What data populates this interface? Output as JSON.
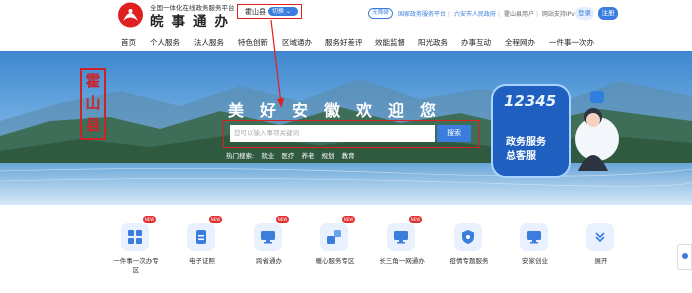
{
  "brand": {
    "subtitle": "全国一体化在线政务服务平台",
    "title": "皖事通办",
    "logo_icon": "anhui-logo-icon",
    "accent": "#e02020"
  },
  "region": {
    "name": "霍山县",
    "switch_label": "切换 ⌄"
  },
  "topbar": {
    "accessibility": "无障碍",
    "links": [
      "国家政务服务平台",
      "六安市人民政府",
      "霍山县用户",
      "网站支持IPv6"
    ],
    "login": "登录",
    "register": "注册",
    "primary_color": "#3b7ddd"
  },
  "nav": [
    "首页",
    "个人服务",
    "法人服务",
    "特色创新",
    "区域通办",
    "服务好差评",
    "效能监督",
    "阳光政务",
    "办事互动",
    "全程网办",
    "一件事一次办"
  ],
  "banner": {
    "seal_text": "霍山县",
    "slogan": "美好安徽欢迎您",
    "search_placeholder": "您可以输入事项关键词",
    "search_button": "搜索",
    "hot_label": "热门搜索:",
    "hot_terms": [
      "就业",
      "医疗",
      "养老",
      "规划",
      "教育"
    ]
  },
  "promo": {
    "number": "12345",
    "line1": "政务服务",
    "line2": "总客服"
  },
  "services": [
    {
      "label": "一件事一次办专区",
      "icon": "grid-icon",
      "badge": "NEW"
    },
    {
      "label": "电子证照",
      "icon": "document-icon",
      "badge": "NEW"
    },
    {
      "label": "跨省通办",
      "icon": "monitor-icon",
      "badge": "NEW"
    },
    {
      "label": "暖心服务专区",
      "icon": "blocks-icon",
      "badge": "NEW"
    },
    {
      "label": "长三角一网通办",
      "icon": "monitor-icon",
      "badge": "NEW"
    },
    {
      "label": "疫情专题服务",
      "icon": "shield-icon",
      "badge": ""
    },
    {
      "label": "安家创业",
      "icon": "monitor-icon",
      "badge": ""
    },
    {
      "label": "展开",
      "icon": "chevron-down-icon",
      "badge": ""
    }
  ]
}
